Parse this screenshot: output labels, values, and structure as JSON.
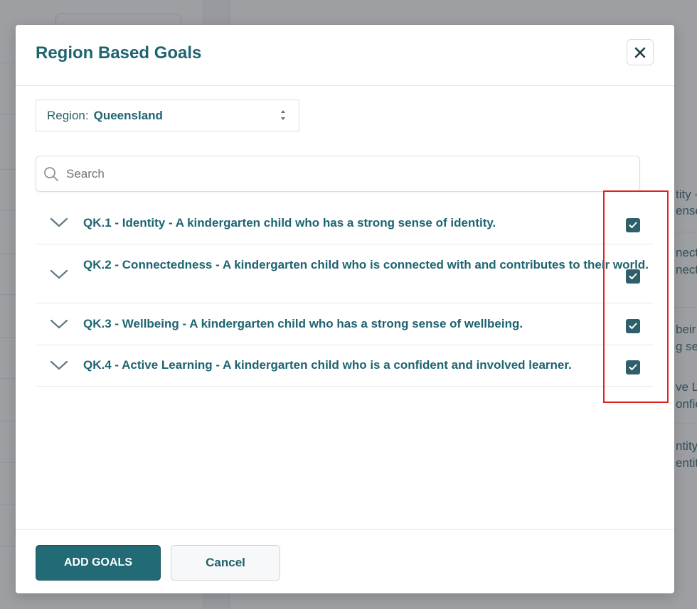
{
  "modal": {
    "title": "Region Based Goals",
    "close_icon": "close-icon"
  },
  "region": {
    "label": "Region:",
    "value": "Queensland"
  },
  "search": {
    "placeholder": "Search",
    "value": ""
  },
  "goals": [
    {
      "text": "QK.1 - Identity - A kindergarten child who has a strong sense of identity.",
      "checked": true
    },
    {
      "text": "QK.2 - Connectedness - A kindergarten child who is connected with and contributes to their world.",
      "checked": true
    },
    {
      "text": "QK.3 - Wellbeing - A kindergarten child who has a strong sense of wellbeing.",
      "checked": true
    },
    {
      "text": "QK.4 - Active Learning - A kindergarten child who is a confident and involved learner.",
      "checked": true
    }
  ],
  "footer": {
    "add_label": "ADD GOALS",
    "cancel_label": "Cancel"
  },
  "background_fragments": [
    "tity -",
    "ense",
    "necti",
    "necti",
    "beir",
    "g se",
    "ve Le",
    "onfic",
    "ntity",
    "entit"
  ],
  "colors": {
    "accent": "#226b76",
    "text": "#1e6470",
    "checkbox": "#2e5f6b",
    "highlight": "#dd2320"
  }
}
